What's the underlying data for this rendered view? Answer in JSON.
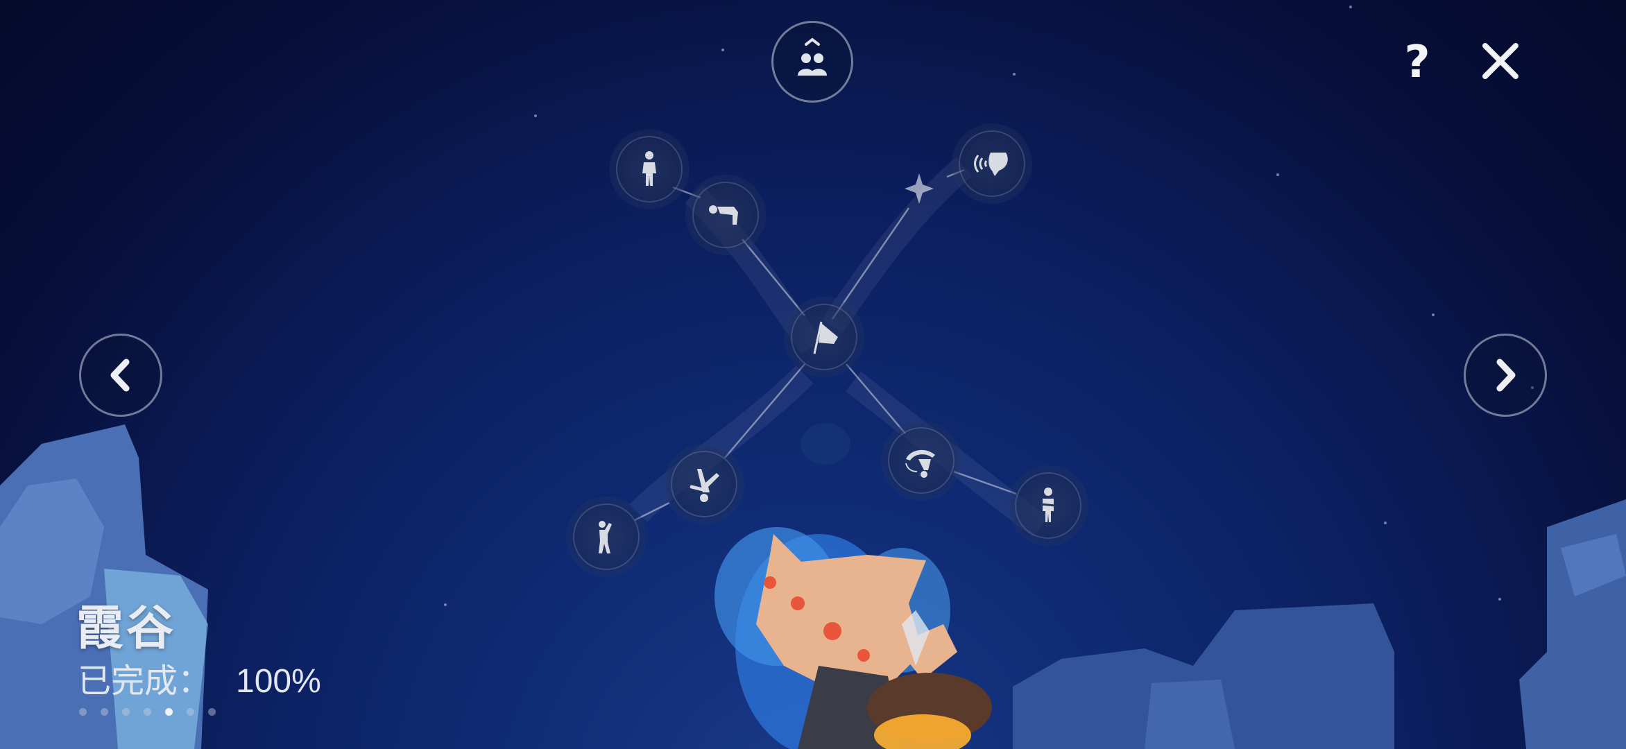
{
  "top": {
    "friends_icon": "friends-icon",
    "help_label": "?",
    "close_icon": "close-icon"
  },
  "nav": {
    "prev_icon": "chevron-left-icon",
    "next_icon": "chevron-right-icon"
  },
  "constellation": {
    "nodes": [
      {
        "name": "spirit-node-standing",
        "icon": "standing-figure-icon"
      },
      {
        "name": "spirit-node-bow",
        "icon": "bowing-figure-icon"
      },
      {
        "name": "spirit-node-shout",
        "icon": "shout-call-icon"
      },
      {
        "name": "spirit-node-center",
        "icon": "cape-flag-icon"
      },
      {
        "name": "spirit-node-cartwheel",
        "icon": "handstand-figure-icon"
      },
      {
        "name": "spirit-node-stretch",
        "icon": "stretching-figure-icon"
      },
      {
        "name": "spirit-node-backflip",
        "icon": "backflip-figure-icon"
      },
      {
        "name": "spirit-node-arms-crossed",
        "icon": "arms-crossed-figure-icon"
      }
    ]
  },
  "realm": {
    "name": "霞谷",
    "completed_label": "已完成：",
    "completed_value": "100%",
    "page_count": 7,
    "active_page": 5
  }
}
